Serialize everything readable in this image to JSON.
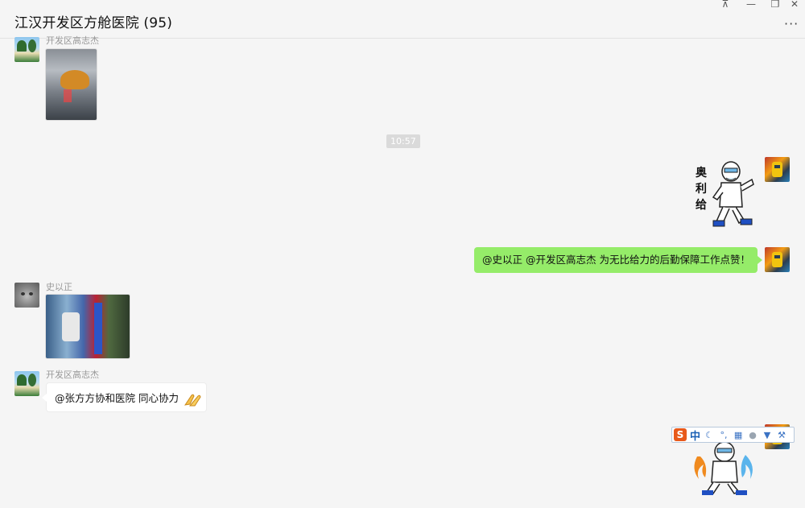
{
  "window": {
    "title": "江汉开发区方舱医院 (95)",
    "controls": {
      "pin": "⊼",
      "minimize": "—",
      "maximize": "❐",
      "close": "✕"
    },
    "more_icon": "···"
  },
  "messages": [
    {
      "type": "image",
      "side": "left",
      "sender": "开发区高志杰",
      "avatar": "beach-avatar"
    },
    {
      "type": "time",
      "text": "10:57"
    },
    {
      "type": "sticker",
      "side": "right",
      "avatar": "robot-avatar",
      "sticker_text": [
        "奥",
        "利",
        "给"
      ]
    },
    {
      "type": "text",
      "side": "right",
      "avatar": "robot-avatar",
      "text": "@史以正 @开发区高志杰 为无比给力的后勤保障工作点赞！"
    },
    {
      "type": "image",
      "side": "left",
      "sender": "史以正",
      "avatar": "cat-avatar"
    },
    {
      "type": "text",
      "side": "left",
      "sender": "开发区高志杰",
      "avatar": "beach-avatar",
      "text": "@张方方协和医院 同心协力",
      "emoji": "clapping-hands-icon"
    },
    {
      "type": "sticker",
      "side": "right",
      "avatar": "robot-avatar"
    }
  ],
  "ime_toolbar": {
    "logo": "S",
    "mode": "中",
    "icons": [
      "moon-icon",
      "punctuation-icon",
      "keyboard-icon",
      "user-icon",
      "skin-icon",
      "wrench-icon"
    ]
  },
  "colors": {
    "background": "#f5f5f5",
    "bubble_self": "#95ec69",
    "bubble_other": "#ffffff",
    "sender_name": "#999999"
  }
}
